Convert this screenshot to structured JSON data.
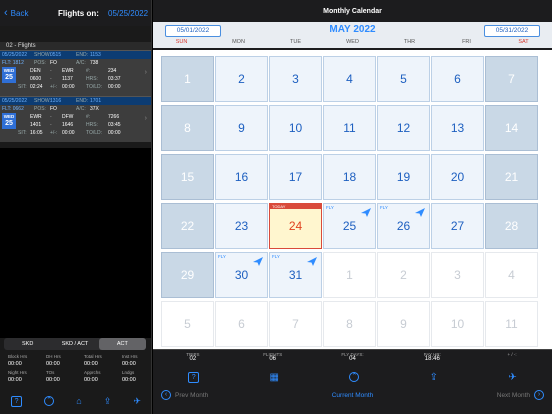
{
  "left": {
    "back_label": "Back",
    "flights_on_label": "Flights on:",
    "flights_on_date": "05/25/2022",
    "flights_header": "02 - Flights",
    "cards": [
      {
        "date": "05/25/2022",
        "show_label": "SHOW:",
        "show_val": "0515",
        "end_label": "END:",
        "end_val": "1153",
        "flt": "FLT: 1812",
        "pos_label": "POS:",
        "pos_val": "FO",
        "ac_label": "A/C:",
        "ac_val": "738",
        "day_abbr": "WED",
        "day_num": "25",
        "from": "DEN",
        "to": "EWR",
        "num_label": "#:",
        "num_val": "234",
        "dep": "0600",
        "arr": "1137",
        "hrs_label": "HRS:",
        "hrs_val": "03:37",
        "sit_label": "SIT:",
        "sit_val": "02:24",
        "pm_label": "+/-:",
        "pm_val": "00:00",
        "told_label": "TO/LD:",
        "told_val": "00:00"
      },
      {
        "date": "05/25/2022",
        "show_label": "SHOW:",
        "show_val": "1316",
        "end_label": "END:",
        "end_val": "1701",
        "flt": "FLT: 0662",
        "pos_label": "POS:",
        "pos_val": "FO",
        "ac_label": "A/C:",
        "ac_val": "37X",
        "day_abbr": "WED",
        "day_num": "25",
        "from": "EWR",
        "to": "DFW",
        "num_label": "#:",
        "num_val": "7266",
        "dep": "1401",
        "arr": "1646",
        "hrs_label": "HRS:",
        "hrs_val": "03:45",
        "sit_label": "SIT:",
        "sit_val": "16:05",
        "pm_label": "+/-:",
        "pm_val": "00:00",
        "told_label": "TO/LD:",
        "told_val": "00:00"
      }
    ],
    "seg": {
      "skd": "SKD",
      "skd_act": "SKD / ACT",
      "act": "ACT"
    },
    "hrs_rows": [
      {
        "labels": [
          "Block Hrs",
          "DH Hrs",
          "Total Hrs",
          "Inst Hrs"
        ],
        "values": [
          "00:00",
          "00:00",
          "00:00",
          "00:00"
        ]
      },
      {
        "labels": [
          "Night Hrs",
          "TOs",
          "Apprchs",
          "Lndgs"
        ],
        "values": [
          "00:00",
          "00:00",
          "00:00",
          "00:00"
        ]
      }
    ]
  },
  "right": {
    "title": "Monthly Calendar",
    "start_date": "05/01/2022",
    "end_date": "05/31/2022",
    "month": "MAY 2022",
    "dow": [
      "SUN",
      "MON",
      "TUE",
      "WED",
      "THR",
      "FRI",
      "SAT"
    ],
    "today_label": "TODAY",
    "fly_label": "FLY",
    "weeks": [
      [
        "1",
        "2",
        "3",
        "4",
        "5",
        "6",
        "7"
      ],
      [
        "8",
        "9",
        "10",
        "11",
        "12",
        "13",
        "14"
      ],
      [
        "15",
        "16",
        "17",
        "18",
        "19",
        "20",
        "21"
      ],
      [
        "22",
        "23",
        "24",
        "25",
        "26",
        "27",
        "28"
      ],
      [
        "29",
        "30",
        "31",
        "1",
        "2",
        "3",
        "4"
      ],
      [
        "5",
        "6",
        "7",
        "8",
        "9",
        "10",
        "11"
      ]
    ],
    "stats": [
      {
        "label": "TRIPS",
        "value": "02"
      },
      {
        "label": "FLIGHTS",
        "value": "06"
      },
      {
        "label": "FLY DAYS:",
        "value": "04"
      },
      {
        "label": "PAY HR:",
        "value": "18:46"
      },
      {
        "label": "+ / -:",
        "value": ""
      }
    ],
    "nav": {
      "prev": "Prev Month",
      "current": "Current Month",
      "next": "Next Month"
    }
  },
  "colors": {
    "accent": "#2f8cff",
    "today": "#d94a3a",
    "weekend": "#c9d8e6"
  },
  "icons": [
    "back-chevron-icon",
    "help-icon",
    "home-icon",
    "share-icon",
    "airport-icon",
    "calendar-icon",
    "up-circle-icon",
    "plane-icon"
  ]
}
